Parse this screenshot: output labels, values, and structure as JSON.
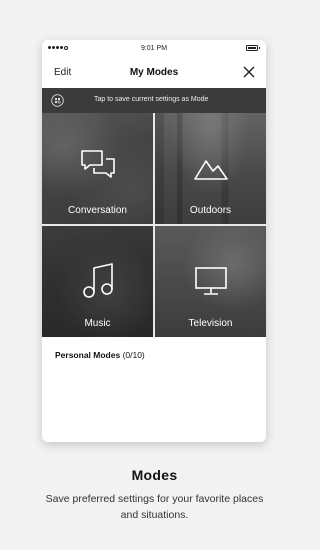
{
  "status_bar": {
    "time": "9:01 PM"
  },
  "nav": {
    "edit": "Edit",
    "title": "My Modes"
  },
  "banner": {
    "text": "Tap to save current settings as Mode"
  },
  "modes": [
    {
      "label": "Conversation",
      "icon": "chat-bubbles-icon"
    },
    {
      "label": "Outdoors",
      "icon": "mountain-icon"
    },
    {
      "label": "Music",
      "icon": "music-note-icon"
    },
    {
      "label": "Television",
      "icon": "television-icon"
    }
  ],
  "personal": {
    "label": "Personal Modes",
    "count": "(0/10)"
  },
  "caption": {
    "title": "Modes",
    "subtitle": "Save preferred settings for your favorite places and situations."
  }
}
